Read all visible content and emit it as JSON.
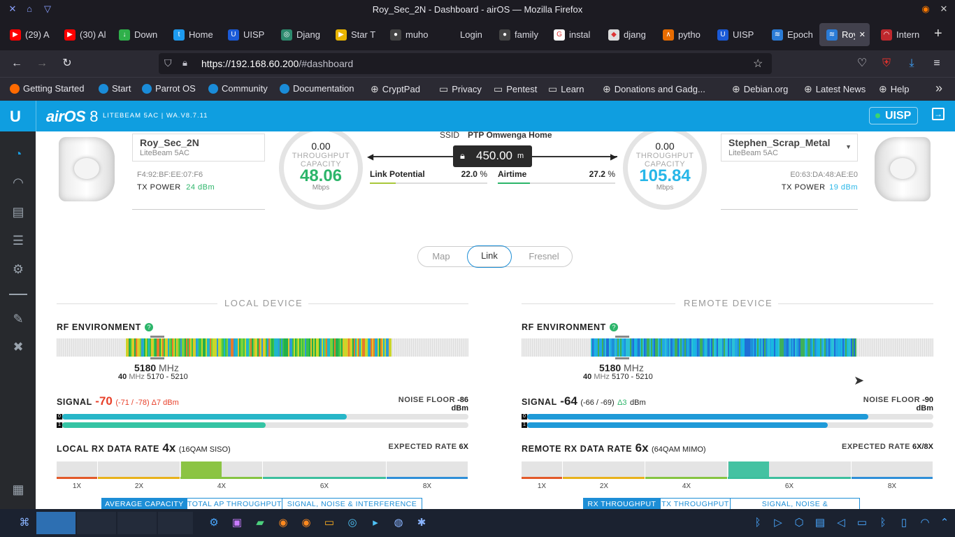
{
  "window": {
    "title": "Roy_Sec_2N - Dashboard - airOS — Mozilla Firefox"
  },
  "tabs": [
    {
      "label": "(29) A",
      "color": "#ff0000",
      "glyph": "▶"
    },
    {
      "label": "(30) Al",
      "color": "#ff0000",
      "glyph": "▶"
    },
    {
      "label": "Down",
      "color": "#2fb04a",
      "glyph": "↓"
    },
    {
      "label": "Home",
      "color": "#1d9bf0",
      "glyph": "t"
    },
    {
      "label": "UISP",
      "color": "#1a5ad7",
      "glyph": "U"
    },
    {
      "label": "Djang",
      "color": "#2d8a6e",
      "glyph": "◎"
    },
    {
      "label": "Star T",
      "color": "#e8b400",
      "glyph": "▶"
    },
    {
      "label": "muho",
      "color": "#444",
      "glyph": "●"
    },
    {
      "label": "Login",
      "color": "#1c1b22",
      "glyph": ""
    },
    {
      "label": "family",
      "color": "#444",
      "glyph": "●"
    },
    {
      "label": "instal",
      "color": "#fff",
      "glyph": "G"
    },
    {
      "label": "djang",
      "color": "#ddd",
      "glyph": "◆"
    },
    {
      "label": "pytho",
      "color": "#e86c00",
      "glyph": "∧"
    },
    {
      "label": "UISP",
      "color": "#1a5ad7",
      "glyph": "U"
    },
    {
      "label": "Epoch",
      "color": "#2a7bd6",
      "glyph": "≋"
    },
    {
      "label": "Roy",
      "color": "#2a7bd6",
      "glyph": "≋"
    },
    {
      "label": "Intern",
      "color": "#c0282d",
      "glyph": "◠"
    }
  ],
  "nav": {
    "url_host": "https://192.168.60.200",
    "url_path": "/#dashboard"
  },
  "bookmarks": [
    {
      "label": "Getting Started",
      "color": "#ff6a00"
    },
    {
      "label": "Start",
      "color": "#1a8cd8"
    },
    {
      "label": "Parrot OS",
      "color": "#1a8cd8"
    },
    {
      "label": "Community",
      "color": "#1a8cd8"
    },
    {
      "label": "Documentation",
      "color": "#1a8cd8"
    },
    {
      "label": "CryptPad",
      "color": "#888"
    },
    {
      "label": "Privacy",
      "color": "folder"
    },
    {
      "label": "Pentest",
      "color": "folder"
    },
    {
      "label": "Learn",
      "color": "folder"
    },
    {
      "label": "Donations and Gadg...",
      "color": "#888"
    },
    {
      "label": "Debian.org",
      "color": "#888"
    },
    {
      "label": "Latest News",
      "color": "#888"
    },
    {
      "label": "Help",
      "color": "#888"
    }
  ],
  "airos": {
    "brand": "airOS",
    "version_big": "8",
    "device_line": "LITEBEAM 5AC | WA.V8.7.11",
    "uisp": "UISP"
  },
  "local": {
    "name": "Roy_Sec_2N",
    "model": "LiteBeam 5AC",
    "mac": "F4:92:BF:EE:07:F6",
    "tx_label": "TX POWER",
    "tx_value": "24 dBm",
    "capacity": "48.06",
    "unit": "Mbps",
    "throughput": "0.00"
  },
  "link": {
    "ssid_label": "SSID",
    "ssid": "PTP Omwenga Home",
    "distance": "450.00",
    "distance_unit": "m",
    "potential_label": "Link Potential",
    "potential": "22.0",
    "airtime_label": "Airtime",
    "airtime": "27.2",
    "pct": "%",
    "throughput_label": "THROUGHPUT",
    "capacity_label": "CAPACITY",
    "potential_fill": 0.22,
    "airtime_fill": 0.272
  },
  "remote": {
    "name": "Stephen_Scrap_Metal",
    "model": "LiteBeam 5AC",
    "mac": "E0:63:DA:48:AE:E0",
    "tx_label": "TX POWER",
    "tx_value": "19 dBm",
    "capacity": "105.84",
    "unit": "Mbps",
    "throughput": "0.00"
  },
  "view_tabs": [
    "Map",
    "Link",
    "Fresnel"
  ],
  "local_panel": {
    "heading": "LOCAL DEVICE",
    "rf": "RF ENVIRONMENT",
    "freq": "5180",
    "freq_unit": "MHz",
    "width": "40",
    "width_unit": "MHz",
    "range": "5170 - 5210",
    "signal_label": "SIGNAL",
    "signal": "-70",
    "signal_detail": "(-71 / -78) Δ7 dBm",
    "noise_label": "NOISE FLOOR",
    "noise": "-86 dBm",
    "chain0_fill": 0.7,
    "chain1_fill": 0.5,
    "rate_label": "LOCAL RX DATA RATE",
    "rate": "4x",
    "rate_detail": "(16QAM SISO)",
    "expected_label": "EXPECTED RATE",
    "expected": "6X",
    "ticks": [
      "1X",
      "2X",
      "4X",
      "6X",
      "8X"
    ],
    "buttons": [
      "AVERAGE CAPACITY",
      "TOTAL AP THROUGHPUT",
      "SIGNAL, NOISE & INTERFERENCE"
    ]
  },
  "remote_panel": {
    "heading": "REMOTE DEVICE",
    "rf": "RF ENVIRONMENT",
    "freq": "5180",
    "freq_unit": "MHz",
    "width": "40",
    "width_unit": "MHz",
    "range": "5170 - 5210",
    "signal_label": "SIGNAL",
    "signal": "-64",
    "signal_detail": "(-66 / -69)",
    "signal_delta": "Δ3",
    "signal_unit": "dBm",
    "noise_label": "NOISE FLOOR",
    "noise": "-90 dBm",
    "chain0_fill": 0.84,
    "chain1_fill": 0.74,
    "rate_label": "REMOTE RX DATA RATE",
    "rate": "6x",
    "rate_detail": "(64QAM MIMO)",
    "expected_label": "EXPECTED RATE",
    "expected": "6X/8X",
    "ticks": [
      "1X",
      "2X",
      "4X",
      "6X",
      "8X"
    ],
    "buttons": [
      "RX THROUGHPUT",
      "TX THROUGHPUT",
      "SIGNAL, NOISE & INTERFERENCE"
    ]
  },
  "colors": {
    "accent": "#0f9ee0",
    "green": "#2cb56a",
    "red": "#e8402a",
    "cyan": "#27b6e8"
  }
}
